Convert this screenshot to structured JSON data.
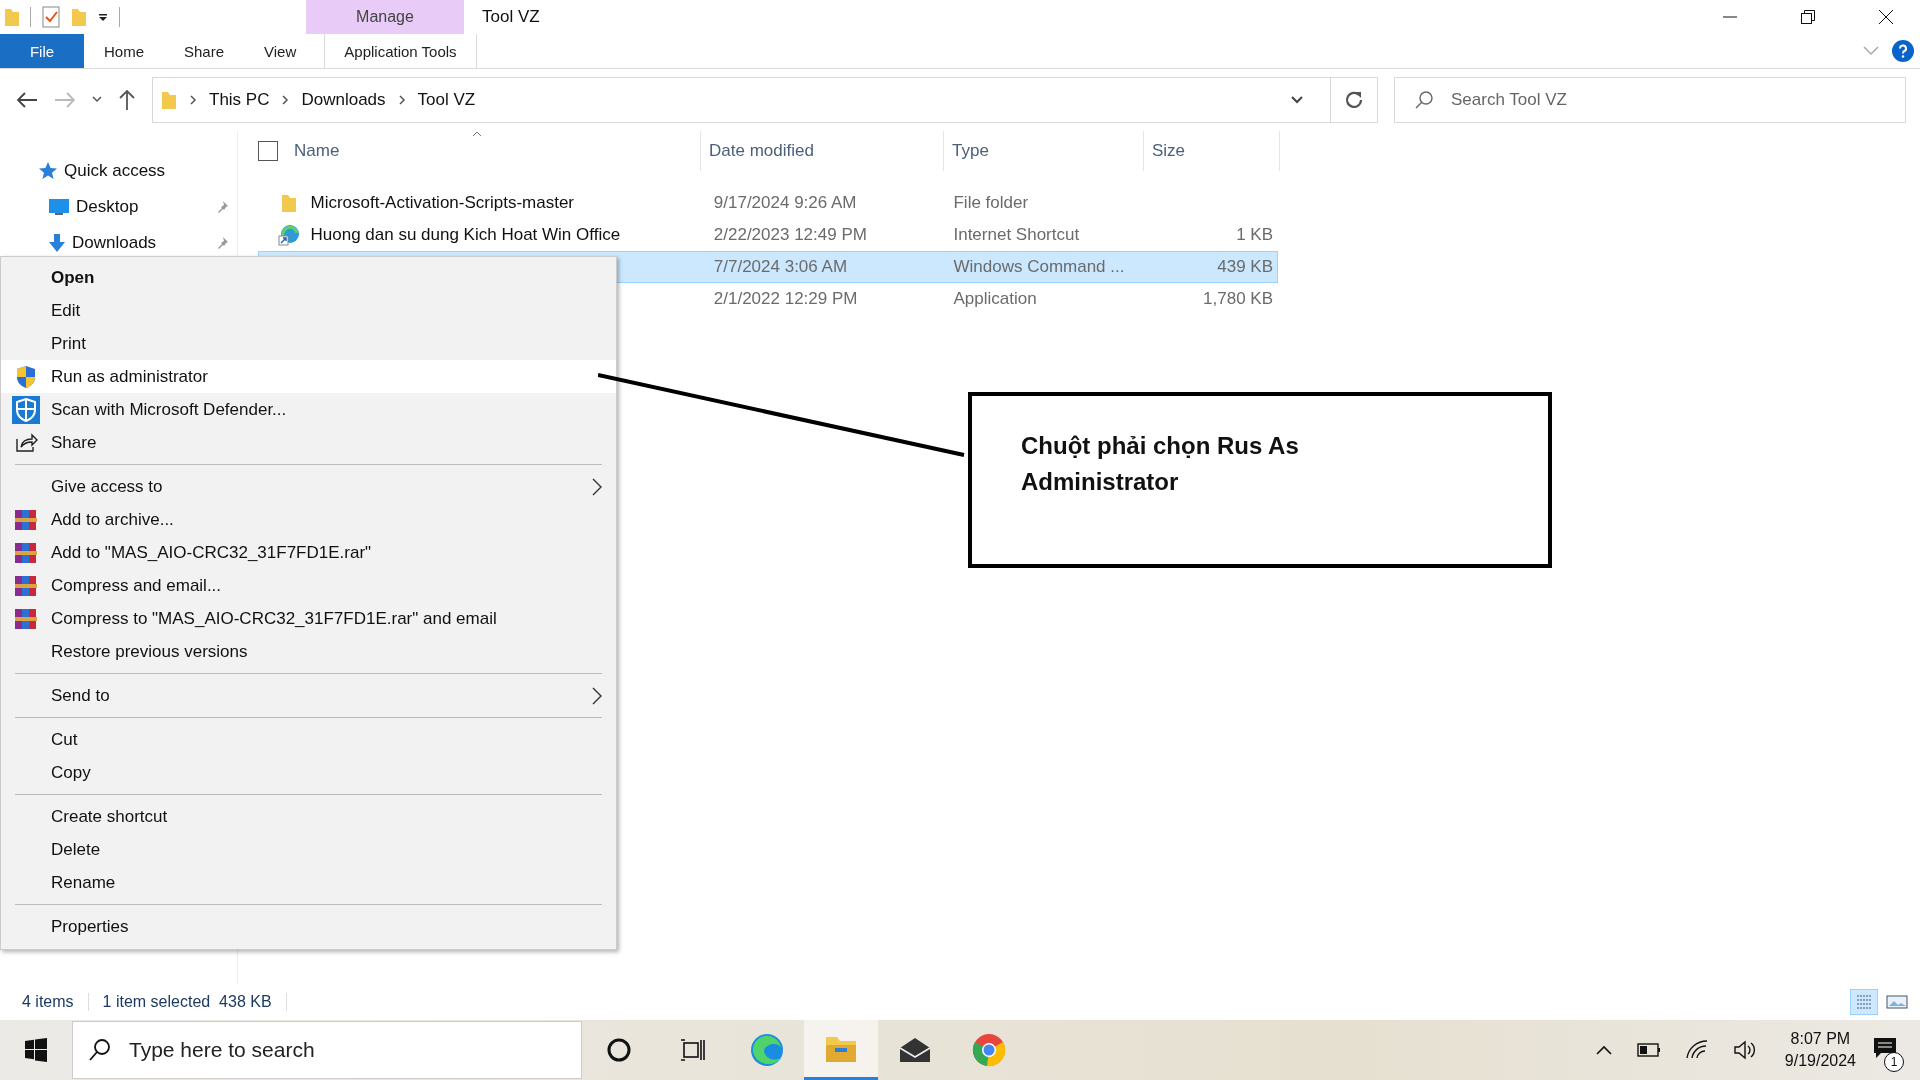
{
  "window": {
    "title": "Tool VZ",
    "context_tab": "Manage"
  },
  "ribbon_tabs": [
    {
      "label": "File",
      "kind": "file",
      "selected": false
    },
    {
      "label": "Home",
      "kind": "tab",
      "selected": false
    },
    {
      "label": "Share",
      "kind": "tab",
      "selected": false
    },
    {
      "label": "View",
      "kind": "tab",
      "selected": false
    },
    {
      "label": "Application Tools",
      "kind": "context",
      "selected": true
    }
  ],
  "breadcrumb": [
    "This PC",
    "Downloads",
    "Tool VZ"
  ],
  "search": {
    "placeholder": "Search Tool VZ"
  },
  "sidebar": {
    "items": [
      {
        "label": "Quick access",
        "kind": "star",
        "pinned": false
      },
      {
        "label": "Desktop",
        "kind": "desktop",
        "pinned": true
      },
      {
        "label": "Downloads",
        "kind": "download",
        "pinned": true
      }
    ]
  },
  "table": {
    "select_all_checked": false,
    "columns": [
      "Name",
      "Date modified",
      "Type",
      "Size"
    ],
    "rows": [
      {
        "kind": "folder",
        "name": "Microsoft-Activation-Scripts-master",
        "date": "9/17/2024 9:26 AM",
        "type": "File folder",
        "selected": false
      },
      {
        "kind": "link",
        "name": "Huong dan su dung Kich Hoat Win Office",
        "date": "2/22/2023 12:49 PM",
        "type": "Internet Shortcut",
        "size": "1 KB",
        "selected": false
      },
      {
        "kind": "script",
        "date": "7/7/2024 3:06 AM",
        "type": "Windows Command ...",
        "size": "439 KB",
        "selected": true
      },
      {
        "kind": "app",
        "date": "2/1/2022 12:29 PM",
        "type": "Application",
        "size": "1,780 KB",
        "selected": false
      }
    ]
  },
  "context_menu": [
    {
      "kind": "default",
      "label": "Open",
      "selected": false
    },
    {
      "kind": "plain",
      "label": "Edit",
      "selected": false
    },
    {
      "kind": "plain",
      "label": "Print",
      "selected": false
    },
    {
      "kind": "admin",
      "label": "Run as administrator",
      "selected": true
    },
    {
      "kind": "defender",
      "label": "Scan with Microsoft Defender...",
      "selected": false
    },
    {
      "kind": "share",
      "label": "Share",
      "selected": false
    },
    {
      "kind": "separator"
    },
    {
      "kind": "submenu",
      "label": "Give access to",
      "selected": false
    },
    {
      "kind": "archive",
      "label": "Add to archive...",
      "selected": false
    },
    {
      "kind": "archive",
      "label": "Add to \"MAS_AIO-CRC32_31F7FD1E.rar\"",
      "selected": false
    },
    {
      "kind": "archive",
      "label": "Compress and email...",
      "selected": false
    },
    {
      "kind": "archive",
      "label": "Compress to \"MAS_AIO-CRC32_31F7FD1E.rar\" and email",
      "selected": false
    },
    {
      "kind": "plain",
      "label": "Restore previous versions",
      "selected": false
    },
    {
      "kind": "separator"
    },
    {
      "kind": "submenu",
      "label": "Send to",
      "selected": false
    },
    {
      "kind": "separator"
    },
    {
      "kind": "plain",
      "label": "Cut",
      "selected": false
    },
    {
      "kind": "plain",
      "label": "Copy",
      "selected": false
    },
    {
      "kind": "separator"
    },
    {
      "kind": "plain",
      "label": "Create shortcut",
      "selected": false
    },
    {
      "kind": "plain",
      "label": "Delete",
      "selected": false
    },
    {
      "kind": "plain",
      "label": "Rename",
      "selected": false
    },
    {
      "kind": "separator"
    },
    {
      "kind": "plain",
      "label": "Properties",
      "selected": false
    }
  ],
  "callout": {
    "lines": [
      "Chuột phải chọn Rus As",
      "Administrator"
    ]
  },
  "status_bar": {
    "count": "4 items",
    "selection": "1 item selected  438 KB"
  },
  "taskbar": {
    "search_placeholder": "Type here to search",
    "time": "8:07 PM",
    "date": "9/19/2024",
    "notifications": "1",
    "apps": [
      {
        "kind": "cortana",
        "selected": false
      },
      {
        "kind": "taskview",
        "selected": false
      },
      {
        "kind": "edge",
        "selected": false
      },
      {
        "kind": "explorer",
        "selected": true
      },
      {
        "kind": "mail",
        "selected": false
      },
      {
        "kind": "chrome",
        "selected": false
      }
    ]
  }
}
